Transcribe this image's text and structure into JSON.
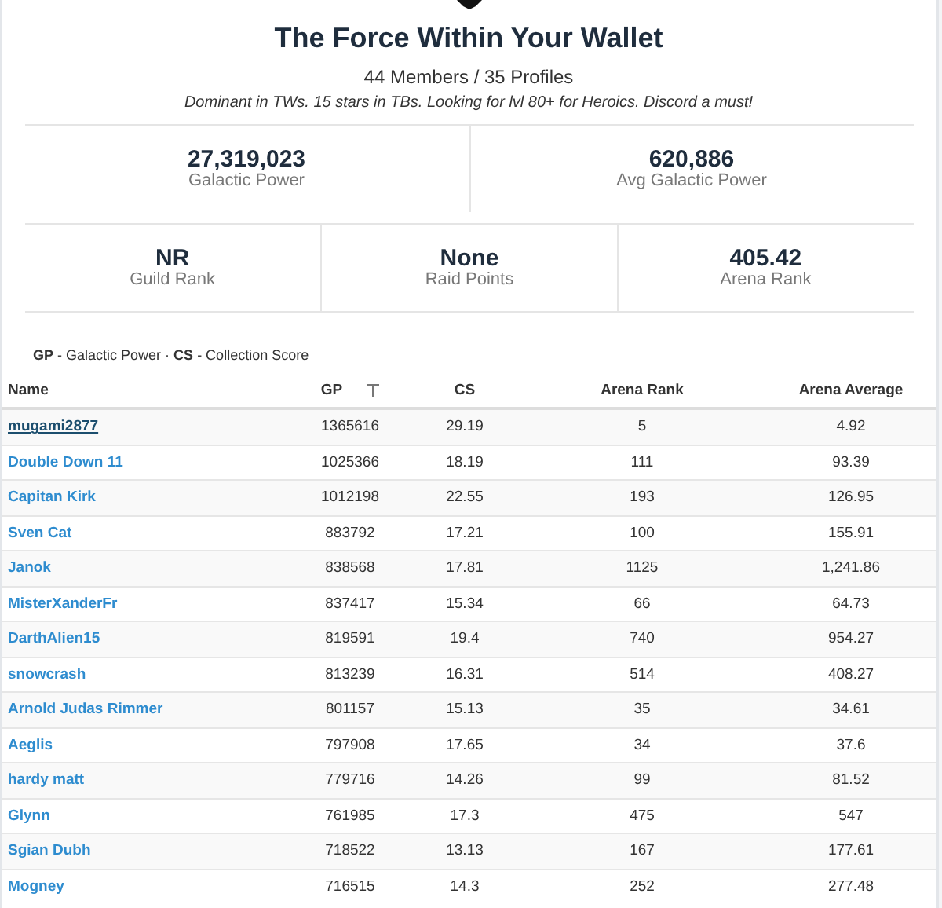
{
  "guild": {
    "name": "The Force Within Your Wallet",
    "counts": "44 Members / 35 Profiles",
    "description": "Dominant in TWs. 15 stars in TBs. Looking for lvl 80+ for Heroics. Discord a must!"
  },
  "stats_top": [
    {
      "value": "27,319,023",
      "label": "Galactic Power"
    },
    {
      "value": "620,886",
      "label": "Avg Galactic Power"
    }
  ],
  "stats_bottom": [
    {
      "value": "NR",
      "label": "Guild Rank"
    },
    {
      "value": "None",
      "label": "Raid Points"
    },
    {
      "value": "405.42",
      "label": "Arena Rank"
    }
  ],
  "legend": "**GP** - Galactic Power · **CS** - Collection Score",
  "table": {
    "columns": [
      {
        "label": "Name",
        "sortable": false
      },
      {
        "label": "GP",
        "sortable": true
      },
      {
        "label": "CS",
        "sortable": false
      },
      {
        "label": "Arena Rank",
        "sortable": false
      },
      {
        "label": "Arena Average",
        "sortable": false
      }
    ],
    "rows": [
      {
        "name": "mugami2877",
        "hovered": true,
        "gp": "1365616",
        "cs": "29.19",
        "arena_rank": "5",
        "arena_average": "4.92"
      },
      {
        "name": "Double Down 11",
        "hovered": false,
        "gp": "1025366",
        "cs": "18.19",
        "arena_rank": "111",
        "arena_average": "93.39"
      },
      {
        "name": "Capitan Kirk",
        "hovered": false,
        "gp": "1012198",
        "cs": "22.55",
        "arena_rank": "193",
        "arena_average": "126.95"
      },
      {
        "name": "Sven Cat",
        "hovered": false,
        "gp": "883792",
        "cs": "17.21",
        "arena_rank": "100",
        "arena_average": "155.91"
      },
      {
        "name": "Janok",
        "hovered": false,
        "gp": "838568",
        "cs": "17.81",
        "arena_rank": "1125",
        "arena_average": "1,241.86"
      },
      {
        "name": "MisterXanderFr",
        "hovered": false,
        "gp": "837417",
        "cs": "15.34",
        "arena_rank": "66",
        "arena_average": "64.73"
      },
      {
        "name": "DarthAlien15",
        "hovered": false,
        "gp": "819591",
        "cs": "19.4",
        "arena_rank": "740",
        "arena_average": "954.27"
      },
      {
        "name": "snowcrash",
        "hovered": false,
        "gp": "813239",
        "cs": "16.31",
        "arena_rank": "514",
        "arena_average": "408.27"
      },
      {
        "name": "Arnold Judas Rimmer",
        "hovered": false,
        "gp": "801157",
        "cs": "15.13",
        "arena_rank": "35",
        "arena_average": "34.61"
      },
      {
        "name": "Aeglis",
        "hovered": false,
        "gp": "797908",
        "cs": "17.65",
        "arena_rank": "34",
        "arena_average": "37.6"
      },
      {
        "name": "hardy matt",
        "hovered": false,
        "gp": "779716",
        "cs": "14.26",
        "arena_rank": "99",
        "arena_average": "81.52"
      },
      {
        "name": "Glynn",
        "hovered": false,
        "gp": "761985",
        "cs": "17.3",
        "arena_rank": "475",
        "arena_average": "547"
      },
      {
        "name": "Sgian Dubh",
        "hovered": false,
        "gp": "718522",
        "cs": "13.13",
        "arena_rank": "167",
        "arena_average": "177.61"
      },
      {
        "name": "Mogney",
        "hovered": false,
        "gp": "716515",
        "cs": "14.3",
        "arena_rank": "252",
        "arena_average": "277.48"
      }
    ]
  }
}
